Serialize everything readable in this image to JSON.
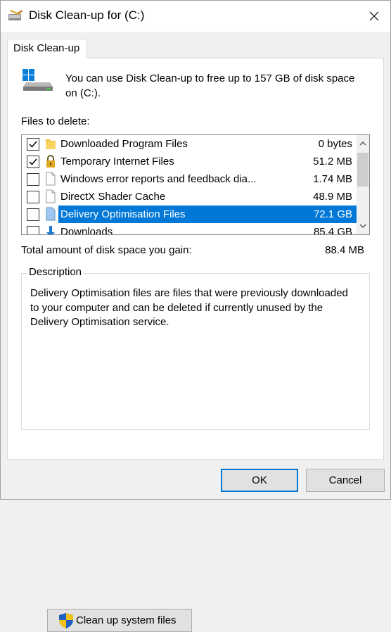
{
  "window": {
    "title": "Disk Clean-up for  (C:)",
    "close_icon": "close-icon"
  },
  "tab": {
    "label": "Disk Clean-up"
  },
  "intro": "You can use Disk Clean-up to free up to 157 GB of disk space on  (C:).",
  "files_label": "Files to delete:",
  "files": [
    {
      "label": "Downloaded Program Files",
      "size": "0 bytes",
      "checked": true,
      "icon": "folder-icon"
    },
    {
      "label": "Temporary Internet Files",
      "size": "51.2 MB",
      "checked": true,
      "icon": "lock-icon"
    },
    {
      "label": "Windows error reports and feedback dia...",
      "size": "1.74 MB",
      "checked": false,
      "icon": "document-icon"
    },
    {
      "label": "DirectX Shader Cache",
      "size": "48.9 MB",
      "checked": false,
      "icon": "document-icon"
    },
    {
      "label": "Delivery Optimisation Files",
      "size": "72.1 GB",
      "checked": false,
      "icon": "document-icon",
      "selected": true
    },
    {
      "label": "Downloads",
      "size": "85.4 GB",
      "checked": false,
      "icon": "download-icon"
    }
  ],
  "total_label": "Total amount of disk space you gain:",
  "total_value": "88.4 MB",
  "description": {
    "title": "Description",
    "text": "Delivery Optimisation files are files that were previously downloaded to your computer and can be deleted if currently unused by the Delivery Optimisation service."
  },
  "buttons": {
    "cleanup_system": "Clean up system files",
    "ok": "OK",
    "cancel": "Cancel"
  },
  "colors": {
    "accent": "#0078d7",
    "selection": "#0078d7"
  }
}
